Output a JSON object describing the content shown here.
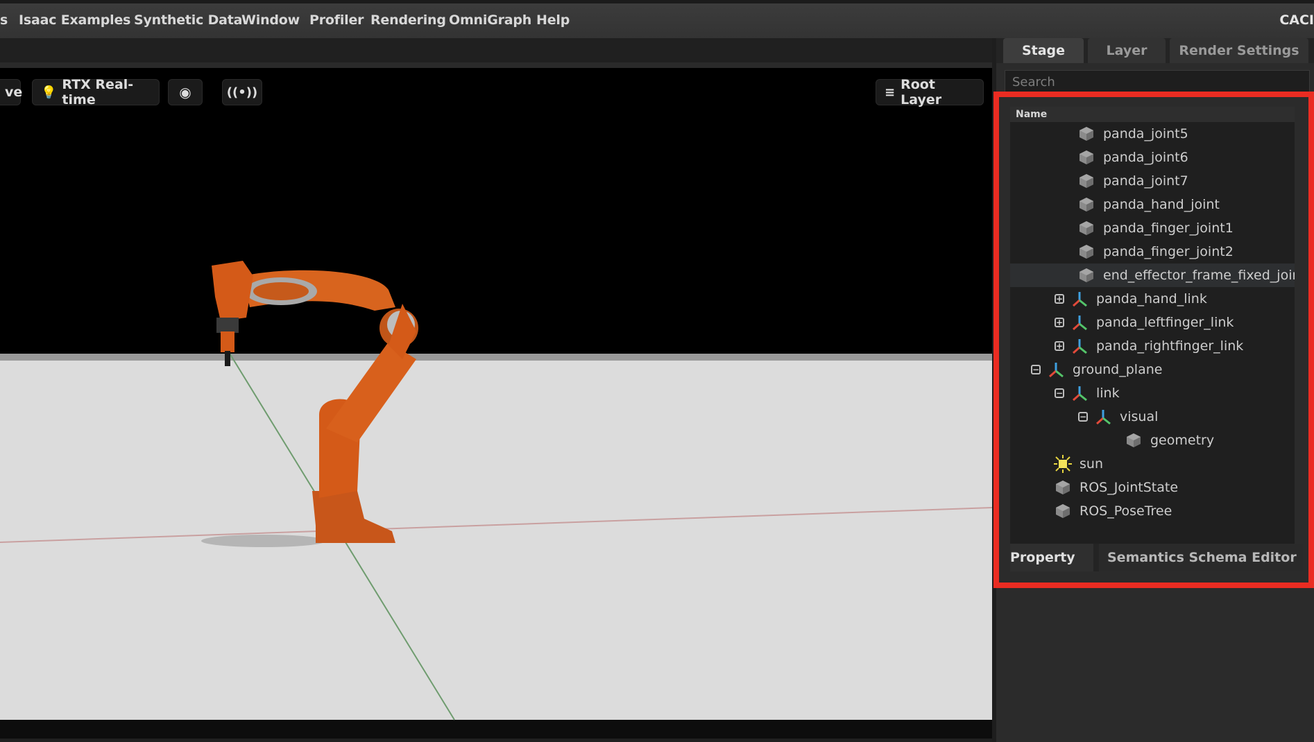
{
  "menubar": {
    "items": [
      "s",
      "Isaac Examples",
      "Synthetic Data",
      "Window",
      "Profiler",
      "Rendering",
      "OmniGraph",
      "Help"
    ],
    "right_text": "CACI"
  },
  "viewport": {
    "cut_label": "ve",
    "rtx_label": "RTX Real-time",
    "eye_icon": "eye-icon",
    "signal_icon": "broadcast-icon",
    "root_layer_label": "Root Layer"
  },
  "stage": {
    "tabs": [
      "Stage",
      "Layer",
      "Render Settings"
    ],
    "search_placeholder": "Search",
    "column_name": "Name",
    "items": [
      {
        "label": "panda_joint5",
        "icon": "cube"
      },
      {
        "label": "panda_joint6",
        "icon": "cube"
      },
      {
        "label": "panda_joint7",
        "icon": "cube"
      },
      {
        "label": "panda_hand_joint",
        "icon": "cube"
      },
      {
        "label": "panda_finger_joint1",
        "icon": "cube"
      },
      {
        "label": "panda_finger_joint2",
        "icon": "cube"
      },
      {
        "label": "end_effector_frame_fixed_joint",
        "icon": "cube"
      },
      {
        "label": "panda_hand_link",
        "icon": "xform"
      },
      {
        "label": "panda_leftfinger_link",
        "icon": "xform"
      },
      {
        "label": "panda_rightfinger_link",
        "icon": "xform"
      },
      {
        "label": "ground_plane",
        "icon": "xform"
      },
      {
        "label": "link",
        "icon": "xform"
      },
      {
        "label": "visual",
        "icon": "xform"
      },
      {
        "label": "geometry",
        "icon": "cube"
      },
      {
        "label": "sun",
        "icon": "light"
      },
      {
        "label": "ROS_JointState",
        "icon": "cube"
      },
      {
        "label": "ROS_PoseTree",
        "icon": "cube"
      }
    ],
    "bottom_tabs": [
      "Property",
      "Semantics Schema Editor"
    ]
  },
  "colors": {
    "highlight": "#ea2c22",
    "robot_orange": "#d45a18",
    "floor": "#dcdcdc"
  }
}
